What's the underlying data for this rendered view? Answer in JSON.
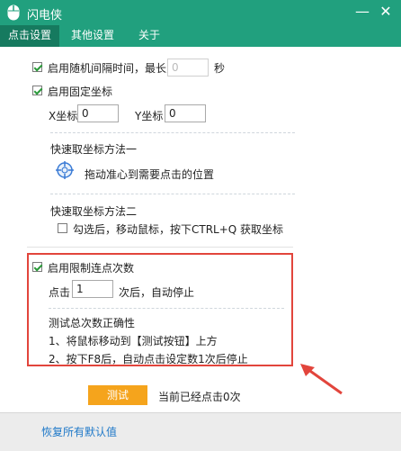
{
  "app": {
    "title": "闪电侠",
    "icon": "mouse-icon"
  },
  "window_controls": {
    "minimize": "—",
    "close": "✕"
  },
  "tabs": [
    {
      "label": "点击设置",
      "active": true
    },
    {
      "label": "其他设置",
      "active": false
    },
    {
      "label": "关于",
      "active": false
    }
  ],
  "random_interval": {
    "label": "启用随机间隔时间，最长为",
    "checked": true,
    "value": "0",
    "unit": "秒"
  },
  "fixed_coords": {
    "label": "启用固定坐标",
    "checked": true,
    "x_label": "X坐标",
    "x_value": "0",
    "y_label": "Y坐标",
    "y_value": "0"
  },
  "method1": {
    "title": "快速取坐标方法一",
    "desc": "拖动准心到需要点击的位置",
    "icon": "crosshair-icon"
  },
  "method2": {
    "title": "快速取坐标方法二",
    "checkbox_label": "勾选后，移动鼠标，按下CTRL+Q 获取坐标",
    "checked": false
  },
  "limit_clicks": {
    "label": "启用限制连点次数",
    "checked": true,
    "prefix": "点击",
    "value": "1",
    "suffix": "次后，自动停止"
  },
  "test_info": {
    "title": "测试总次数正确性",
    "step1": "1、将鼠标移动到【测试按钮】上方",
    "step2": "2、按下F8后，自动点击设定数1次后停止"
  },
  "test": {
    "button_label": "测试",
    "status": "当前已经点击0次"
  },
  "footer": {
    "reset_label": "恢复所有默认值"
  },
  "colors": {
    "titlebar": "#21a07e",
    "active_tab": "#167a5f",
    "highlight": "#e2453c",
    "test_button": "#f5a41c",
    "link": "#1e78c8"
  }
}
